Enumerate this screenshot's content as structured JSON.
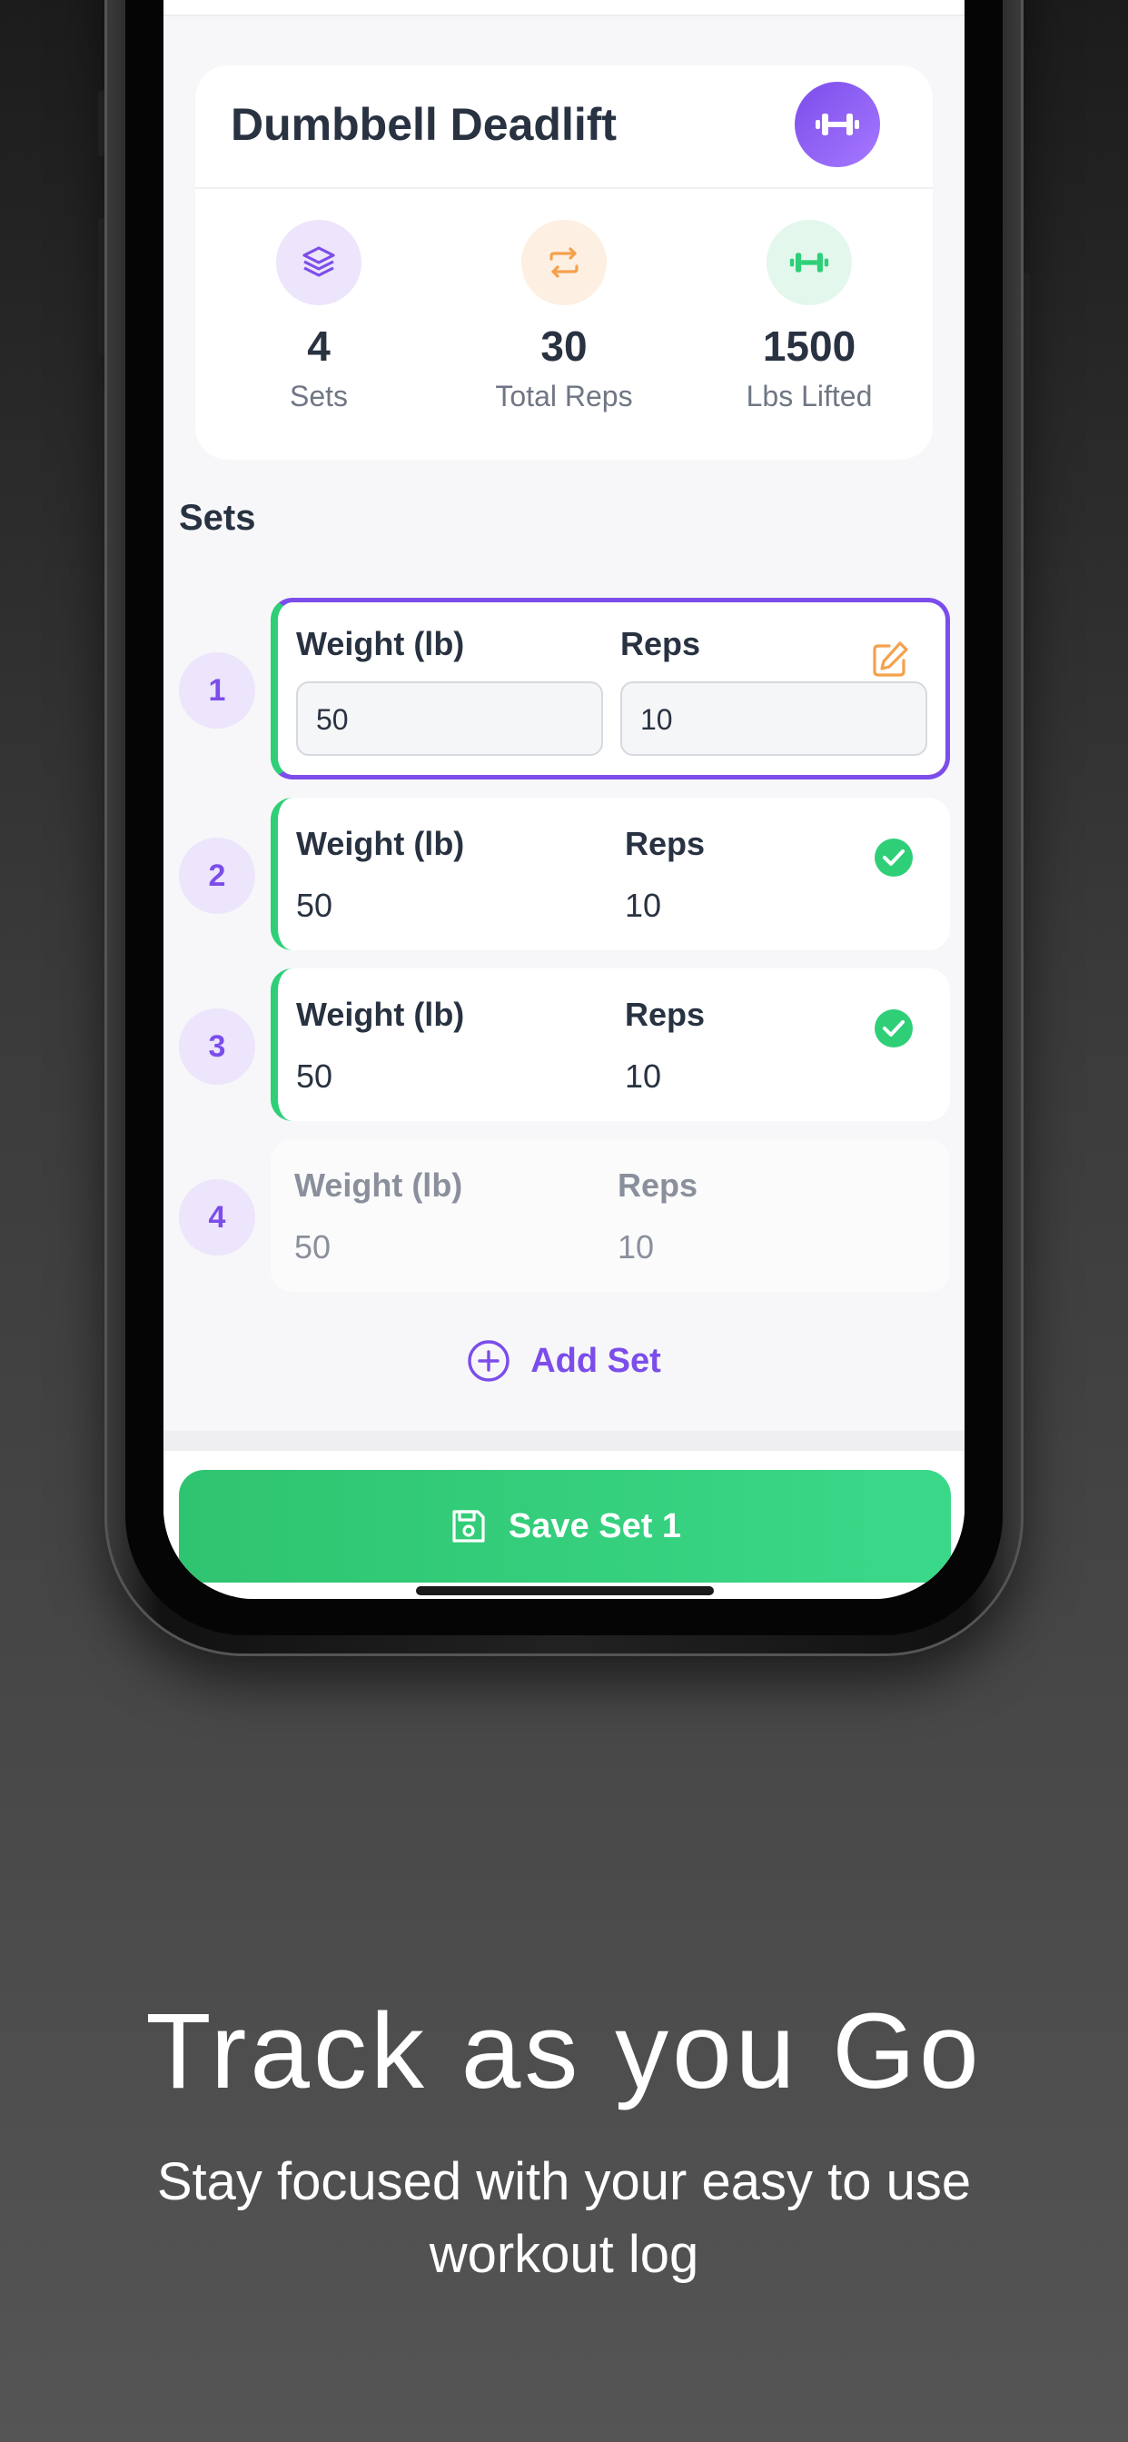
{
  "exercise": {
    "title": "Dumbbell Deadlift",
    "icon": "dumbbell-icon"
  },
  "stats": [
    {
      "value": "4",
      "label": "Sets",
      "icon": "layers-icon",
      "color": "#7c4dea"
    },
    {
      "value": "30",
      "label": "Total Reps",
      "icon": "repeat-icon",
      "color": "#f5a14b"
    },
    {
      "value": "1500",
      "label": "Lbs Lifted",
      "icon": "dumbbell-icon",
      "color": "#2fcf78"
    }
  ],
  "sets_heading": "Sets",
  "sets": [
    {
      "number": "1",
      "weight_label": "Weight (lb)",
      "reps_label": "Reps",
      "weight": "50",
      "reps": "10",
      "state": "active",
      "status_icon": "edit-icon"
    },
    {
      "number": "2",
      "weight_label": "Weight (lb)",
      "reps_label": "Reps",
      "weight": "50",
      "reps": "10",
      "state": "done",
      "status_icon": "check-circle-icon"
    },
    {
      "number": "3",
      "weight_label": "Weight (lb)",
      "reps_label": "Reps",
      "weight": "50",
      "reps": "10",
      "state": "done",
      "status_icon": "check-circle-icon"
    },
    {
      "number": "4",
      "weight_label": "Weight (lb)",
      "reps_label": "Reps",
      "weight": "50",
      "reps": "10",
      "state": "pending",
      "status_icon": ""
    }
  ],
  "add_set_label": "Add Set",
  "save_button_label": "Save Set 1",
  "marketing": {
    "headline": "Track as you Go",
    "subline": "Stay focused with your easy to use workout log"
  },
  "colors": {
    "accent_purple": "#7c4dea",
    "success_green": "#2fcf78",
    "edit_orange": "#f5a14b",
    "text_dark": "#283241"
  }
}
